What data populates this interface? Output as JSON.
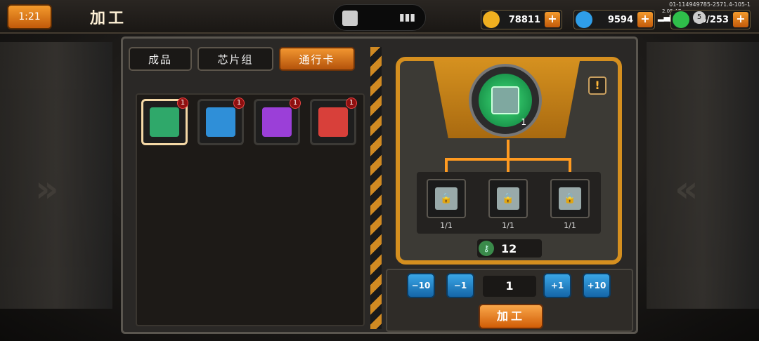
{
  "header": {
    "back_label": "1:21",
    "title": "加工",
    "device_id": "01-114949785-2571.4-105-1",
    "net": "2.05 4G",
    "popup_count": "5"
  },
  "resources": {
    "gold": {
      "value": "78811",
      "icon": "coin-icon"
    },
    "crystal": {
      "value": "9594",
      "icon": "crystal-icon"
    },
    "energy": {
      "value": "56/253",
      "icon": "energy-icon"
    },
    "plus": "+"
  },
  "tabs": [
    {
      "label": "成品",
      "active": false
    },
    {
      "label": "芯片组",
      "active": false
    },
    {
      "label": "通行卡",
      "active": true
    }
  ],
  "cards": [
    {
      "color": "#2fa86a",
      "count": "1",
      "selected": true
    },
    {
      "color": "#2f8fd8",
      "count": "1",
      "selected": false
    },
    {
      "color": "#9b3fd8",
      "count": "1",
      "selected": false
    },
    {
      "color": "#d8403a",
      "count": "1",
      "selected": false
    }
  ],
  "target": {
    "count": "1",
    "warn": "!"
  },
  "materials": [
    {
      "count": "1/1"
    },
    {
      "count": "1/1"
    },
    {
      "count": "1/1"
    }
  ],
  "key": {
    "value": "12"
  },
  "controls": {
    "minus10": "−10",
    "minus1": "−1",
    "quantity": "1",
    "plus1": "+1",
    "plus10": "+10",
    "craft": "加工"
  }
}
